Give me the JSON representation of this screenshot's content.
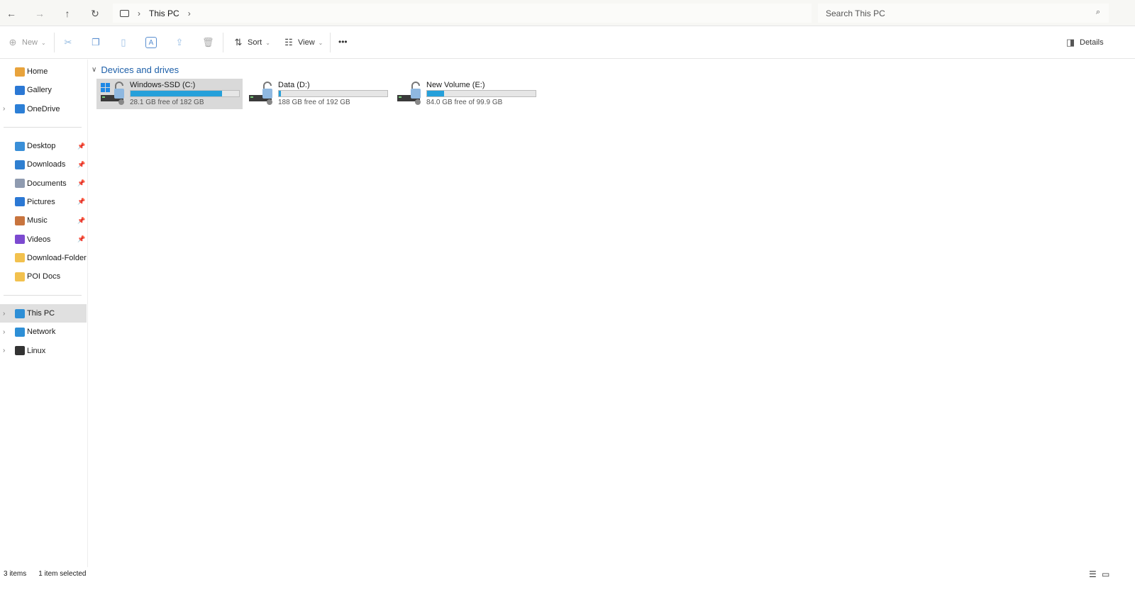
{
  "nav": {
    "back": "←",
    "forward": "→",
    "up": "↑",
    "refresh": "↻"
  },
  "address": {
    "crumbs": [
      "This PC"
    ]
  },
  "search": {
    "placeholder": "Search This PC"
  },
  "toolbar": {
    "new": "New",
    "sort": "Sort",
    "view": "View",
    "more": "•••",
    "details": "Details"
  },
  "sidebar": {
    "group1": [
      {
        "label": "Home",
        "color": "#e8a33c"
      },
      {
        "label": "Gallery",
        "color": "#2b78d4"
      },
      {
        "label": "OneDrive",
        "color": "#2c7fd6",
        "expand": true
      }
    ],
    "group2": [
      {
        "label": "Desktop",
        "color": "#3a8fd8",
        "pin": true
      },
      {
        "label": "Downloads",
        "color": "#2f7fd0",
        "pin": true
      },
      {
        "label": "Documents",
        "color": "#8f9bb0",
        "pin": true
      },
      {
        "label": "Pictures",
        "color": "#2b78d4",
        "pin": true
      },
      {
        "label": "Music",
        "color": "#c8743e",
        "pin": true
      },
      {
        "label": "Videos",
        "color": "#7c4ad0",
        "pin": true
      },
      {
        "label": "Download-Folder",
        "color": "#f2c14e"
      },
      {
        "label": "POI Docs",
        "color": "#f2c14e"
      }
    ],
    "group3": [
      {
        "label": "This PC",
        "color": "#2e8fd6",
        "selected": true
      },
      {
        "label": "Network",
        "color": "#2e8fd6"
      },
      {
        "label": "Linux",
        "color": "#333333"
      }
    ]
  },
  "section": {
    "title": "Devices and drives"
  },
  "drives": [
    {
      "name": "Windows-SSD (C:)",
      "free": "28.1 GB free of 182 GB",
      "used_fraction": 0.846,
      "selected": true
    },
    {
      "name": "Data (D:)",
      "free": "188 GB free of 192 GB",
      "used_fraction": 0.021
    },
    {
      "name": "New Volume (E:)",
      "free": "84.0 GB free of 99.9 GB",
      "used_fraction": 0.159
    }
  ],
  "status": {
    "items": "3 items",
    "selected": "1 item selected"
  }
}
